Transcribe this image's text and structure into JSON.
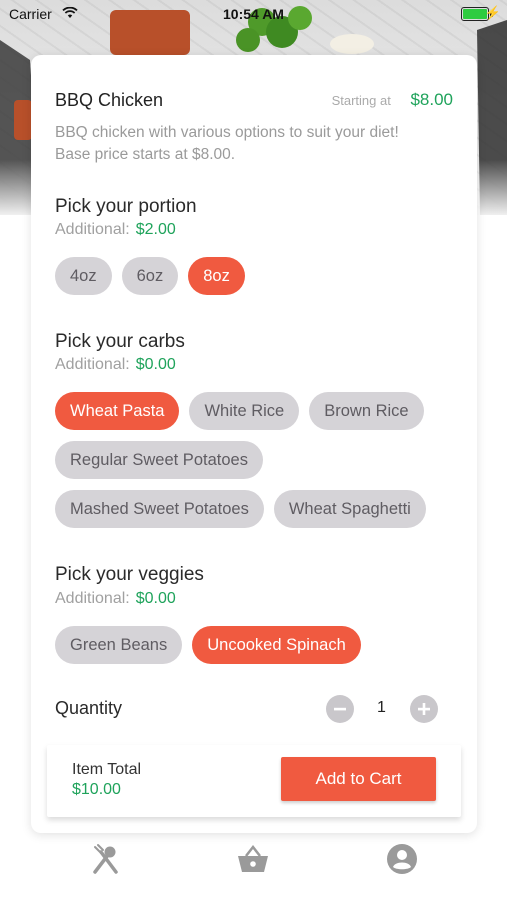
{
  "status_bar": {
    "carrier": "Carrier",
    "time": "10:54 AM"
  },
  "item": {
    "title": "BBQ Chicken",
    "starting_label": "Starting at",
    "starting_price": "$8.00",
    "description": "BBQ chicken with various options to suit your diet! Base price starts at $8.00."
  },
  "portion": {
    "title": "Pick your portion",
    "additional_label": "Additional:",
    "additional_amount": "$2.00",
    "options": [
      "4oz",
      "6oz",
      "8oz"
    ],
    "selected": "8oz"
  },
  "carbs": {
    "title": "Pick your carbs",
    "additional_label": "Additional:",
    "additional_amount": "$0.00",
    "options": [
      "Wheat Pasta",
      "White Rice",
      "Brown Rice",
      "Regular Sweet Potatoes",
      "Mashed Sweet Potatoes",
      "Wheat Spaghetti"
    ],
    "selected": "Wheat Pasta"
  },
  "veggies": {
    "title": "Pick your veggies",
    "additional_label": "Additional:",
    "additional_amount": "$0.00",
    "options": [
      "Green Beans",
      "Uncooked Spinach"
    ],
    "selected": "Uncooked Spinach"
  },
  "quantity": {
    "label": "Quantity",
    "value": "1"
  },
  "footer": {
    "total_label": "Item Total",
    "total_value": "$10.00",
    "add_button": "Add to Cart"
  },
  "tabs": [
    {
      "icon": "utensils-icon"
    },
    {
      "icon": "basket-icon"
    },
    {
      "icon": "account-icon"
    }
  ],
  "colors": {
    "accent": "#f05a40",
    "price_green": "#1fa35b",
    "chip_bg": "#d5d3d7"
  }
}
